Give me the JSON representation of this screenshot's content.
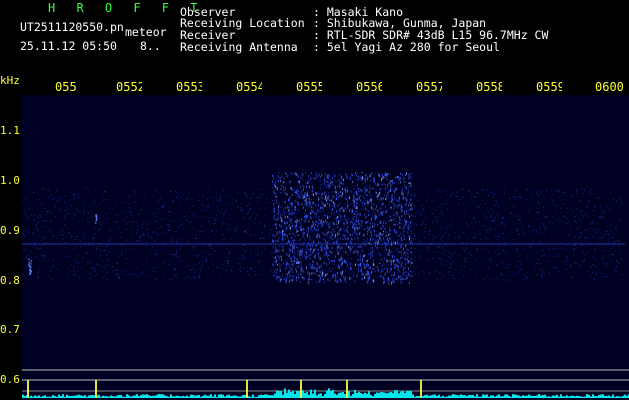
{
  "station": {
    "name": "H R O F F T",
    "file": "UT2511120550.pn",
    "kind": "meteor",
    "datetime": "25.11.12 05:50",
    "extra": "8.."
  },
  "info": [
    {
      "label": "Observer",
      "value": ": Masaki Kano"
    },
    {
      "label": "Receiving Location",
      "value": ": Shibukawa, Gunma, Japan"
    },
    {
      "label": "Receiver",
      "value": ": RTL-SDR SDR# 43dB L15 96.7MHz CW"
    },
    {
      "label": "Receiving Antenna",
      "value": ": 5el Yagi Az 280 for Seoul"
    }
  ],
  "axis": {
    "unit": "kHz",
    "time_ticks": [
      "055",
      "0552",
      "0553",
      "0554",
      "0555",
      "0556",
      "0557",
      "0558",
      "0559",
      "0600"
    ],
    "freq_ticks": [
      "1.1",
      "1.0",
      "0.9",
      "0.8",
      "0.7",
      "0.6"
    ]
  },
  "colors": {
    "label_yellow": "#ffff33",
    "title_green": "#33ff33",
    "background": "#000033",
    "signal_blue": "#3355ff",
    "level_cyan": "#00ffff"
  }
}
